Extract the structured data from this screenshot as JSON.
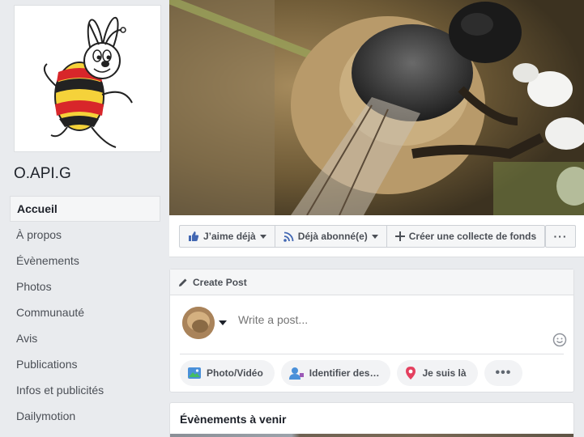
{
  "page": {
    "name": "O.API.G"
  },
  "nav": {
    "items": [
      {
        "label": "Accueil",
        "active": true
      },
      {
        "label": "À propos"
      },
      {
        "label": "Évènements"
      },
      {
        "label": "Photos"
      },
      {
        "label": "Communauté"
      },
      {
        "label": "Avis"
      },
      {
        "label": "Publications"
      },
      {
        "label": "Infos et publicités"
      },
      {
        "label": "Dailymotion"
      }
    ]
  },
  "actions": {
    "like": "J’aime déjà",
    "follow": "Déjà abonné(e)",
    "fundraiser": "Créer une collecte de fonds",
    "more": "···"
  },
  "create_post": {
    "title": "Create Post",
    "placeholder": "Write a post...",
    "buttons": {
      "photo": "Photo/Vidéo",
      "tag": "Identifier des…",
      "checkin": "Je suis là",
      "more": "•••"
    }
  },
  "events": {
    "title": "Évènements à venir"
  },
  "colors": {
    "accent_blue": "#4267b2",
    "background": "#e9ebee",
    "checkin_red": "#e4405f",
    "photo_green": "#45bd62"
  }
}
